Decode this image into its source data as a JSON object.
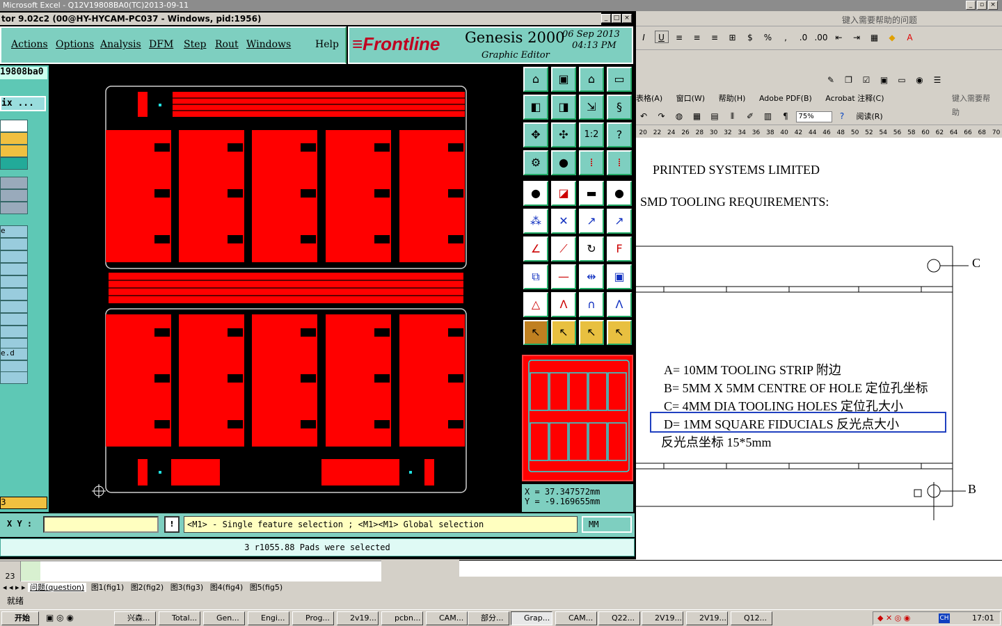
{
  "excel": {
    "title": "Microsoft Excel - Q12V19808BA0(TC)2013-09-11",
    "help_placeholder": "键入需要帮助的问题",
    "status": "就绪",
    "row_number": "23",
    "sheet_tabs": [
      "问题(question)",
      "图1(fig1)",
      "图2(fig2)",
      "图3(fig3)",
      "图4(fig4)",
      "图5(fig5)"
    ],
    "controls": [
      "_",
      "▫",
      "×"
    ]
  },
  "word": {
    "menu": [
      "表格(A)",
      "窗口(W)",
      "帮助(H)",
      "Adobe PDF(B)",
      "Acrobat 注释(C)"
    ],
    "help_placeholder": "键入需要帮助",
    "zoom": "75%",
    "read_label": "阅读(R)",
    "ruler": [
      "20",
      "22",
      "24",
      "26",
      "28",
      "30",
      "32",
      "34",
      "36",
      "38",
      "40",
      "42",
      "44",
      "46",
      "48",
      "50",
      "52",
      "54",
      "56",
      "58",
      "60",
      "62",
      "64",
      "66",
      "68",
      "70"
    ],
    "lines": {
      "company": "PRINTED SYSTEMS LIMITED",
      "heading": "SMD TOOLING REQUIREMENTS:",
      "a": "A=  10MM   TOOLING STRIP 附边",
      "b": "B=   5MM X 5MM     CENTRE OF HOLE 定位孔坐标",
      "c": "C=  4MM DIA TOOLING HOLES 定位孔大小",
      "d": "D=   1MM SQUARE FIDUCIALS 反光点大小",
      "e": "反光点坐标 15*5mm"
    },
    "labels": {
      "c": "C",
      "b": "B"
    }
  },
  "genesis": {
    "title": "tor 9.02c2 (00@HY-HYCAM-PC037 - Windows, pid:1956)",
    "menu": [
      "Actions",
      "Options",
      "Analysis",
      "DFM",
      "Step",
      "Rout",
      "Windows",
      "Help"
    ],
    "logo": "Frontline",
    "product": "Genesis 2000",
    "subtitle": "Graphic Editor",
    "date": "06 Sep 2013",
    "time": "04:13 PM",
    "job_name": "19808ba0",
    "left_label_1": "ix ...",
    "left_label_2": "e",
    "left_label_3": "e.d",
    "left_counter": "3",
    "coord_x": "X = 37.347572mm",
    "coord_y": "Y = -9.169655mm",
    "xy_label": "X Y :",
    "prompt": "<M1> - Single feature selection ; <M1><M1> Global selection",
    "units": "MM",
    "selection_status": "3 r1055.88 Pads were selected",
    "warning_icon": "!"
  },
  "taskbar": {
    "start": "开始",
    "tasks": [
      "兴森...",
      "Total...",
      "Gen...",
      "Engi...",
      "Prog...",
      "2v19...",
      "pcbn...",
      "CAM...",
      "部分...",
      "Grap...",
      "CAM...",
      "Q22...",
      "2V19...",
      "2V19...",
      "Q12..."
    ],
    "clock": "17:01",
    "ime": "CH"
  },
  "colors": {
    "genesis_teal": "#7ecfc0",
    "board_red": "#ff0000",
    "highlight_blue": "#2040c0"
  }
}
